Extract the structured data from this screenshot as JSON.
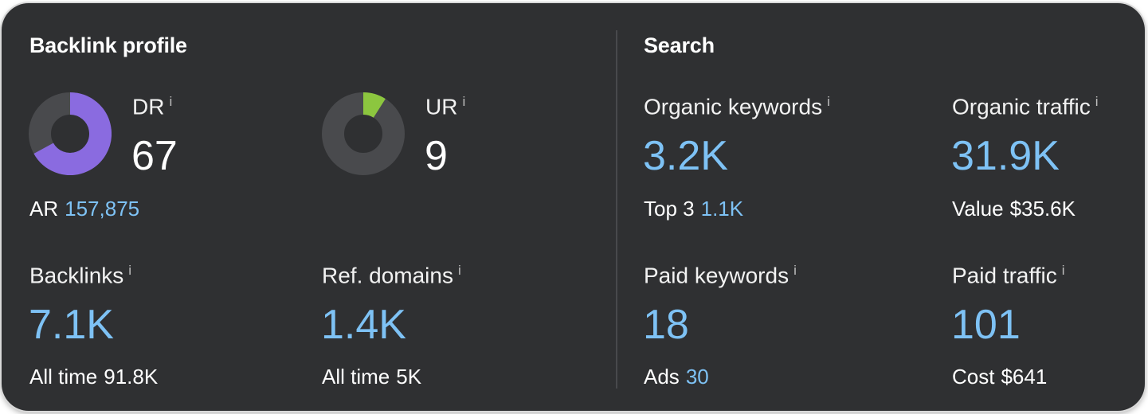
{
  "colors": {
    "background": "#2f3032",
    "metric_blue": "#7ec2f5",
    "dr_donut": "#8a6be0",
    "ur_donut": "#8cc63f",
    "donut_track": "#494a4d"
  },
  "info_icon": "i",
  "backlink_profile": {
    "title": "Backlink profile",
    "dr": {
      "label": "DR",
      "value": "67",
      "fraction": 0.67
    },
    "ur": {
      "label": "UR",
      "value": "9",
      "fraction": 0.09
    },
    "ar": {
      "label": "AR",
      "value": "157,875"
    },
    "backlinks": {
      "label": "Backlinks",
      "value": "7.1K",
      "sub_label": "All time",
      "sub_value": "91.8K"
    },
    "ref_domains": {
      "label": "Ref. domains",
      "value": "1.4K",
      "sub_label": "All time",
      "sub_value": "5K"
    }
  },
  "search": {
    "title": "Search",
    "organic_keywords": {
      "label": "Organic keywords",
      "value": "3.2K",
      "sub_label": "Top 3",
      "sub_value": "1.1K"
    },
    "organic_traffic": {
      "label": "Organic traffic",
      "value": "31.9K",
      "sub_label": "Value",
      "sub_value": "$35.6K"
    },
    "paid_keywords": {
      "label": "Paid keywords",
      "value": "18",
      "sub_label": "Ads",
      "sub_value": "30"
    },
    "paid_traffic": {
      "label": "Paid traffic",
      "value": "101",
      "sub_label": "Cost",
      "sub_value": "$641"
    }
  }
}
